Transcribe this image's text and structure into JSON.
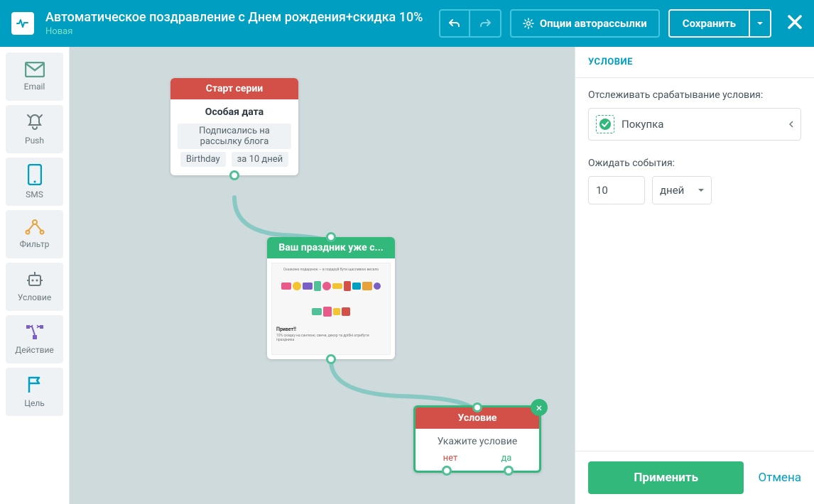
{
  "header": {
    "title": "Автоматическое поздравление с Днем рождения+скидка 10%",
    "status": "Новая",
    "options_label": "Опции авторассылки",
    "save_label": "Сохранить"
  },
  "sidebar": {
    "email": "Email",
    "push": "Push",
    "sms": "SMS",
    "filter": "Фильтр",
    "condition": "Условие",
    "action": "Действие",
    "goal": "Цель"
  },
  "nodes": {
    "start": {
      "title": "Старт серии",
      "subtitle": "Особая дата",
      "chip1": "Подписались на рассылку блога",
      "chip2": "Birthday",
      "chip3": "за 10 дней"
    },
    "email": {
      "title": "Ваш праздник уже с...",
      "preview_greeting": "Привет!!",
      "preview_line": "10% скидку на сантехні, свечи, декор та дрібні атрибути праздника"
    },
    "condition": {
      "title": "Условие",
      "prompt": "Укажите условие",
      "no": "нет",
      "yes": "да"
    }
  },
  "panel": {
    "heading": "УСЛОВИЕ",
    "track_label": "Отслеживать срабатывание условия:",
    "event_name": "Покупка",
    "wait_label": "Ожидать события:",
    "wait_value": "10",
    "wait_unit": "дней",
    "apply": "Применить",
    "cancel": "Отмена"
  }
}
